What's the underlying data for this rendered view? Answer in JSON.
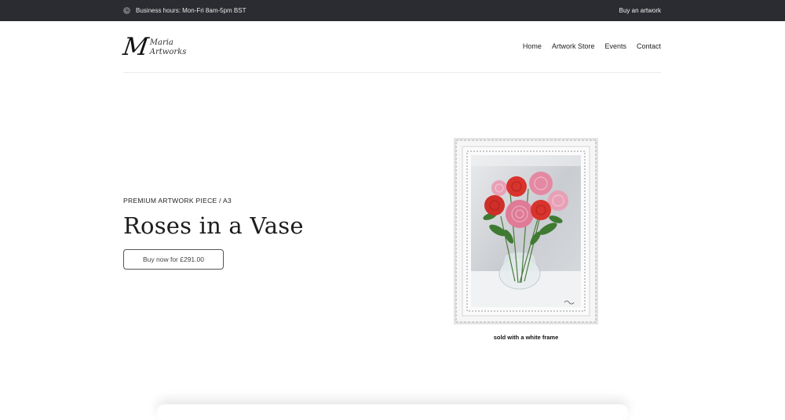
{
  "topbar": {
    "hours": "Business hours: Mon-Fri 8am-5pm BST",
    "buy_link": "Buy an artwork",
    "icon": "clock-icon"
  },
  "header": {
    "logo_mark": "M",
    "logo_line1": "Maria",
    "logo_line2": "Artworks",
    "nav": [
      "Home",
      "Artwork Store",
      "Events",
      "Contact"
    ]
  },
  "hero": {
    "eyebrow": "PREMIUM ARTWORK PIECE / A3",
    "title": "Roses in a Vase",
    "button": "Buy now for £291.00"
  },
  "artwork": {
    "caption": "sold with a white frame",
    "colors": {
      "frame": "#f1f1f1",
      "red_rose": "#d8332c",
      "pink_rose": "#e07b95",
      "leaf": "#3f7a33"
    }
  }
}
